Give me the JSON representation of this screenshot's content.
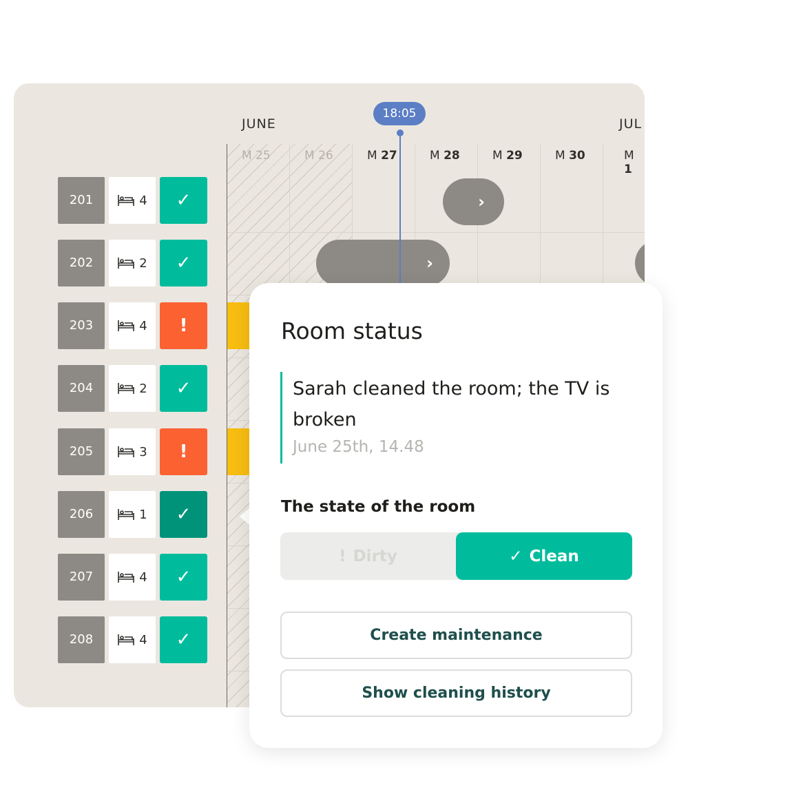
{
  "timeline": {
    "months": [
      "JUNE",
      "JUL"
    ],
    "days": [
      {
        "label": "M",
        "num": "25",
        "past": true
      },
      {
        "label": "M",
        "num": "26",
        "past": true
      },
      {
        "label": "M",
        "num": "27",
        "past": false
      },
      {
        "label": "M",
        "num": "28",
        "past": false
      },
      {
        "label": "M",
        "num": "29",
        "past": false
      },
      {
        "label": "M",
        "num": "30",
        "past": false
      },
      {
        "label": "M",
        "num": "1",
        "past": false
      }
    ],
    "now": "18:05"
  },
  "rooms": [
    {
      "number": "201",
      "beds": "4",
      "status": "clean",
      "glyph": "✓"
    },
    {
      "number": "202",
      "beds": "2",
      "status": "clean",
      "glyph": "✓"
    },
    {
      "number": "203",
      "beds": "4",
      "status": "dirty",
      "glyph": "!"
    },
    {
      "number": "204",
      "beds": "2",
      "status": "clean",
      "glyph": "✓"
    },
    {
      "number": "205",
      "beds": "3",
      "status": "dirty",
      "glyph": "!"
    },
    {
      "number": "206",
      "beds": "1",
      "status": "selected",
      "glyph": "✓"
    },
    {
      "number": "207",
      "beds": "4",
      "status": "clean",
      "glyph": "✓"
    },
    {
      "number": "208",
      "beds": "4",
      "status": "clean",
      "glyph": "✓"
    }
  ],
  "bed_icon": "bed-icon",
  "booking_arrow": "›",
  "popup": {
    "title": "Room status",
    "note": "Sarah cleaned the room; the TV is broken",
    "note_date": "June 25th, 14.48",
    "state_label": "The state of the room",
    "dirty_label": "Dirty",
    "dirty_glyph": "!",
    "clean_label": "Clean",
    "clean_glyph": "✓",
    "btn_maintenance": "Create maintenance",
    "btn_history": "Show cleaning history"
  },
  "colors": {
    "clean": "#00bc9c",
    "dirty": "#fc6132",
    "selected": "#00937a",
    "now": "#5b7ec4",
    "booking": "#8d8a85",
    "occupied": "#f7bd10"
  }
}
